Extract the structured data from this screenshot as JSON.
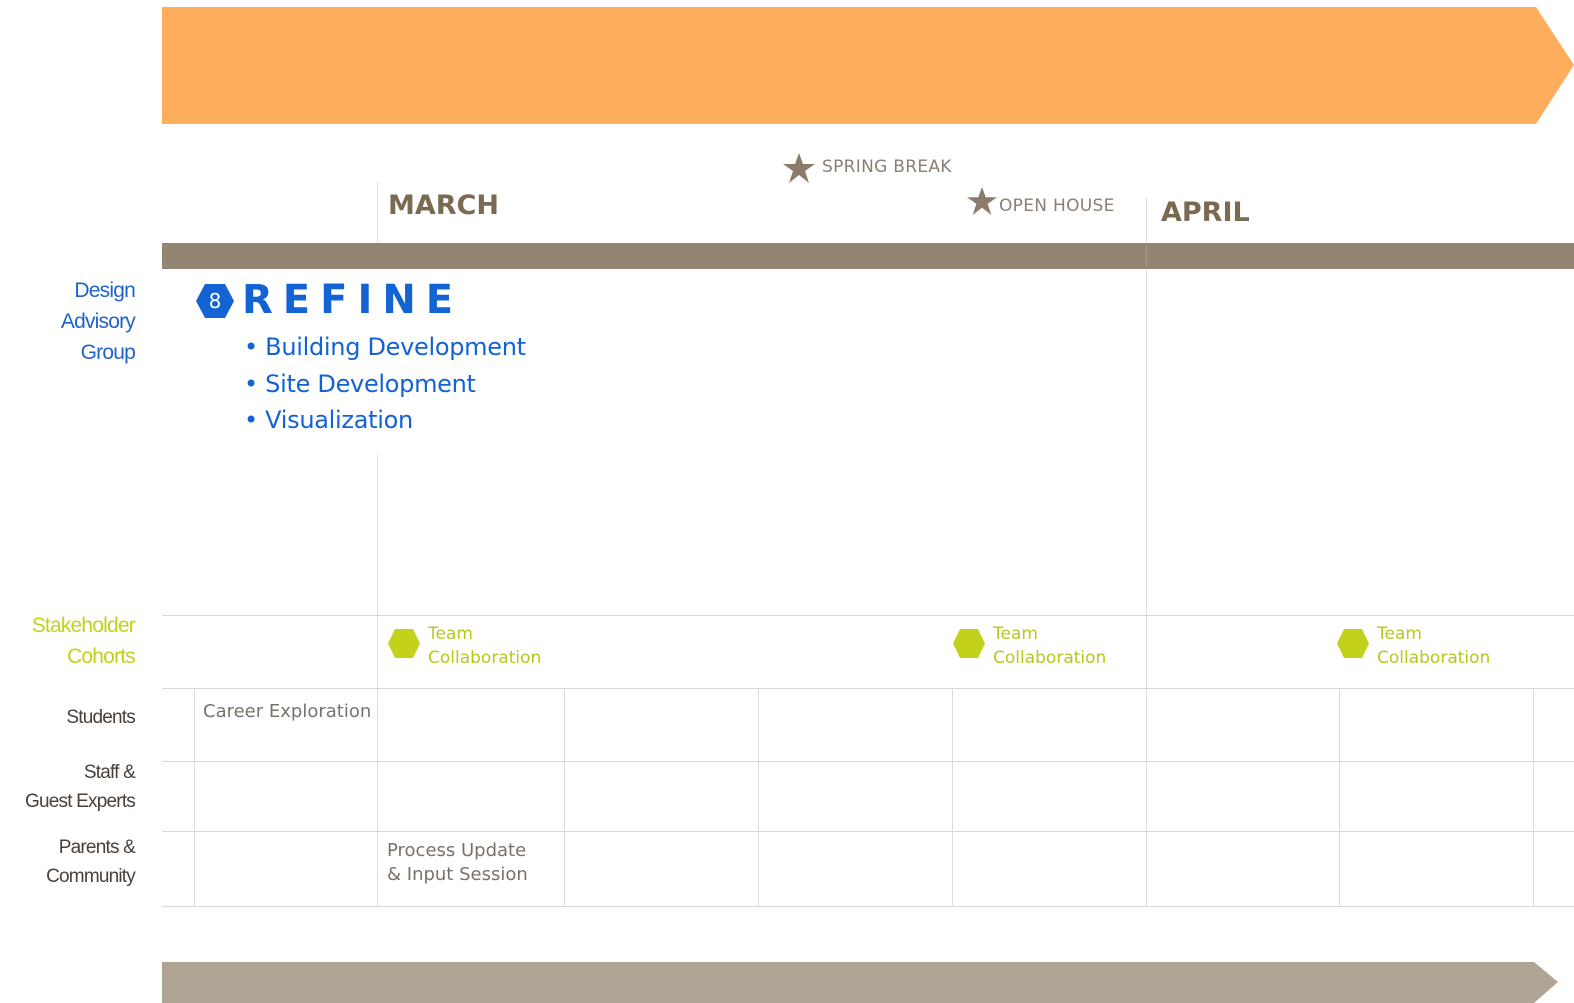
{
  "colors": {
    "top_arrow": "#fead5c",
    "bottom_arrow": "#b0a594",
    "timeline_band": "#948472",
    "month_text": "#7a6a52",
    "event_text": "#8b7f73",
    "star": "#8b7b68",
    "design_blue": "#1363d4",
    "stakeholder_green": "#c4d11a"
  },
  "timeline": {
    "months": [
      "MARCH",
      "APRIL"
    ],
    "events": [
      {
        "label": "SPRING BREAK",
        "icon": "star-icon"
      },
      {
        "label": "OPEN HOUSE",
        "icon": "star-icon"
      }
    ]
  },
  "rows": {
    "design_advisory": [
      "Design",
      "Advisory",
      "Group"
    ],
    "stakeholder_cohorts": [
      "Stakeholder",
      "Cohorts"
    ],
    "students": [
      "Students"
    ],
    "staff": [
      "Staff &",
      "Guest Experts"
    ],
    "parents": [
      "Parents &",
      "Community"
    ]
  },
  "refine": {
    "step_number": "8",
    "title": "REFINE",
    "items": [
      "• Building Development",
      "• Site Development",
      "• Visualization"
    ]
  },
  "collaboration": {
    "icon": "hexagon-icon",
    "entries": [
      [
        "Team",
        "Collaboration"
      ],
      [
        "Team",
        "Collaboration"
      ],
      [
        "Team",
        "Collaboration"
      ]
    ]
  },
  "cells": {
    "career_exploration": "Career Exploration",
    "process_update": [
      "Process Update",
      "& Input Session"
    ]
  }
}
